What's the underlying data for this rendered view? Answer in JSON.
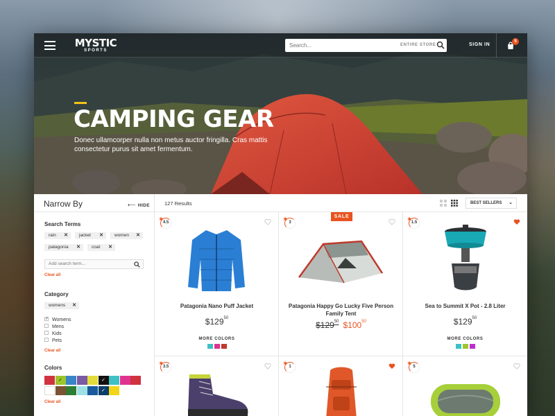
{
  "brand": {
    "name": "MYSTIC",
    "sub": "SPORTS"
  },
  "header": {
    "search_placeholder": "Search...",
    "search_scope": "ENTIRE STORE",
    "sign_in": "SIGN IN",
    "cart_count": "5"
  },
  "hero": {
    "title": "CAMPING GEAR",
    "subtitle": "Donec ullamcorper nulla non metus auctor fringilla. Cras mattis consectetur purus sit amet fermentum."
  },
  "sidebar": {
    "title": "Narrow By",
    "hide": "HIDE",
    "search_terms_title": "Search Terms",
    "search_terms": [
      "rain",
      "jacket",
      "women",
      "patagonia",
      "coat"
    ],
    "add_term_placeholder": "Add search term...",
    "clear_all": "Clear all",
    "category_title": "Category",
    "category_chip": "womens",
    "categories": [
      {
        "label": "Womens",
        "checked": true
      },
      {
        "label": "Mens",
        "checked": false
      },
      {
        "label": "Kids",
        "checked": false
      },
      {
        "label": "Pets",
        "checked": false
      }
    ],
    "colors_title": "Colors",
    "colors": [
      "#d0333f",
      "#9cc62b",
      "#3a84c7",
      "#7b5aa6",
      "#e2dc3a",
      "#111111",
      "#3fc1c4",
      "#e0338f",
      "#d0333f",
      "#ffffff",
      "#7a5334",
      "#2e7d32",
      "#9fe0e6",
      "#1a5a9c",
      "#0b3d6b",
      "#f2d516"
    ],
    "colors_checked": [
      1,
      5,
      14
    ]
  },
  "main": {
    "results": "127 Results",
    "sort": "BEST SELLERS",
    "products": [
      {
        "name": "Patagonia Nano Puff Jacket",
        "rating": "4.5",
        "price_whole": "$129",
        "price_cents": "50",
        "sale": false,
        "favorite": false,
        "more_colors": "MORE COLORS",
        "swatches": [
          "#3fc1c4",
          "#e0338f",
          "#c0392b"
        ]
      },
      {
        "name": "Patagonia Happy Go Lucky Five Person Family Tent",
        "rating": "3",
        "old_whole": "$129",
        "old_cents": "50",
        "price_whole": "$100",
        "price_cents": "50",
        "sale": true,
        "sale_label": "SALE",
        "favorite": false
      },
      {
        "name": "Sea to Summit X Pot - 2.8 Liter",
        "rating": "1.5",
        "price_whole": "$129",
        "price_cents": "50",
        "sale": false,
        "favorite": true,
        "more_colors": "MORE COLORS",
        "swatches": [
          "#3fc1c4",
          "#9cc62b",
          "#c02bd0"
        ]
      },
      {
        "rating": "3.5",
        "favorite": false
      },
      {
        "rating": "1",
        "favorite": true
      },
      {
        "rating": "5",
        "favorite": false
      }
    ]
  }
}
